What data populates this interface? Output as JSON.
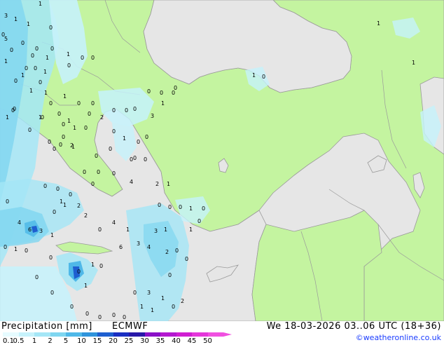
{
  "header": {
    "title": "Precipitation [mm]",
    "model": "ECMWF",
    "datetime": "We 18-03-2026 03..06 UTC (18+36)",
    "credit": "©weatheronline.co.uk"
  },
  "colors": {
    "sea": "#e6e6e6",
    "land": "#c4f4a0",
    "coast": "#9a9a9a",
    "border": "#9a9a9a"
  },
  "legend": {
    "ticks": [
      "0.1",
      "0.5",
      "1",
      "2",
      "5",
      "10",
      "15",
      "20",
      "25",
      "30",
      "35",
      "40",
      "45",
      "50"
    ],
    "colors": [
      "#e6fbff",
      "#c6f2fb",
      "#a4e6f6",
      "#7fd6f0",
      "#4fb8e8",
      "#2f94dc",
      "#1e5fd0",
      "#1a2fc2",
      "#2818a8",
      "#8a10c8",
      "#b418d0",
      "#d01ed2",
      "#e436da",
      "#f050e0"
    ]
  },
  "map_labels": [
    "3",
    "1",
    "1",
    "1",
    "0",
    "5",
    "0",
    "1",
    "1",
    "0",
    "0",
    "0",
    "1",
    "0",
    "0",
    "1",
    "1",
    "1",
    "0",
    "0",
    "0",
    "0",
    "0",
    "0",
    "0",
    "0",
    "0",
    "0",
    "0",
    "1",
    "0",
    "1",
    "1",
    "0",
    "0",
    "0",
    "2",
    "0",
    "0",
    "0",
    "0",
    "0",
    "2",
    "1",
    "4",
    "0",
    "0",
    "0",
    "0",
    "0",
    "0",
    "1",
    "0",
    "0",
    "0",
    "0",
    "0",
    "1",
    "4",
    "6",
    "3",
    "1",
    "1",
    "0",
    "2",
    "2",
    "0",
    "4",
    "1",
    "3",
    "1",
    "0",
    "1",
    "0",
    "1",
    "6",
    "3",
    "4",
    "2",
    "0",
    "0",
    "1",
    "0",
    "0",
    "1",
    "0",
    "0",
    "1",
    "0",
    "0",
    "0",
    "0",
    "0",
    "0",
    "0",
    "0",
    "3",
    "1",
    "0",
    "0",
    "0",
    "1",
    "1",
    "0",
    "2",
    "0",
    "0",
    "3",
    "0",
    "1",
    "0",
    "1",
    "1",
    "1",
    "0",
    "1",
    "0",
    "0",
    "0",
    "1",
    "1",
    "0",
    "2",
    "0",
    "1",
    "0",
    "0",
    "0",
    "0",
    "0",
    "0",
    "0"
  ],
  "icons": [
    "precipitation-map",
    "copyright-icon"
  ]
}
